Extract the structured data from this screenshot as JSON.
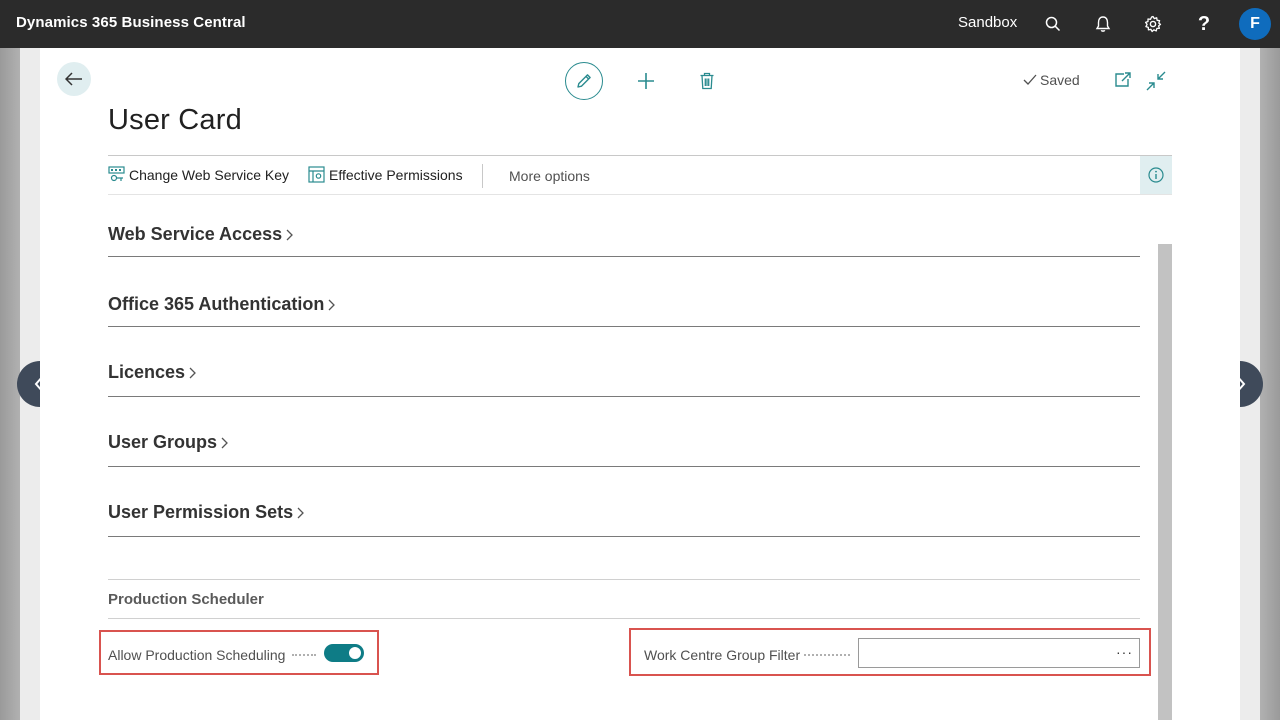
{
  "topbar": {
    "app_title": "Dynamics 365 Business Central",
    "environment": "Sandbox",
    "avatar_initial": "F",
    "help_glyph": "?",
    "icons": [
      "search-icon",
      "bell-icon",
      "gear-icon",
      "help-icon"
    ]
  },
  "page": {
    "title": "User Card",
    "status": "Saved",
    "icons": [
      "back-arrow-icon",
      "pencil-icon",
      "plus-icon",
      "trash-icon",
      "popout-icon",
      "collapse-icon"
    ]
  },
  "actions": {
    "change_web_service_key": "Change Web Service Key",
    "effective_permissions": "Effective Permissions",
    "more_options": "More options"
  },
  "fasttabs": [
    {
      "label": "Web Service Access"
    },
    {
      "label": "Office 365 Authentication"
    },
    {
      "label": "Licences"
    },
    {
      "label": "User Groups"
    },
    {
      "label": "User Permission Sets"
    }
  ],
  "production_scheduler": {
    "title": "Production Scheduler",
    "allow_label": "Allow Production Scheduling",
    "allow_value": true,
    "filter_label": "Work Centre Group Filter",
    "filter_value": "",
    "assist_glyph": "···"
  },
  "colors": {
    "accent": "#0e7c86",
    "highlight": "#d9534f",
    "topbar": "#2b2b2b",
    "avatar": "#0f6cbd"
  }
}
